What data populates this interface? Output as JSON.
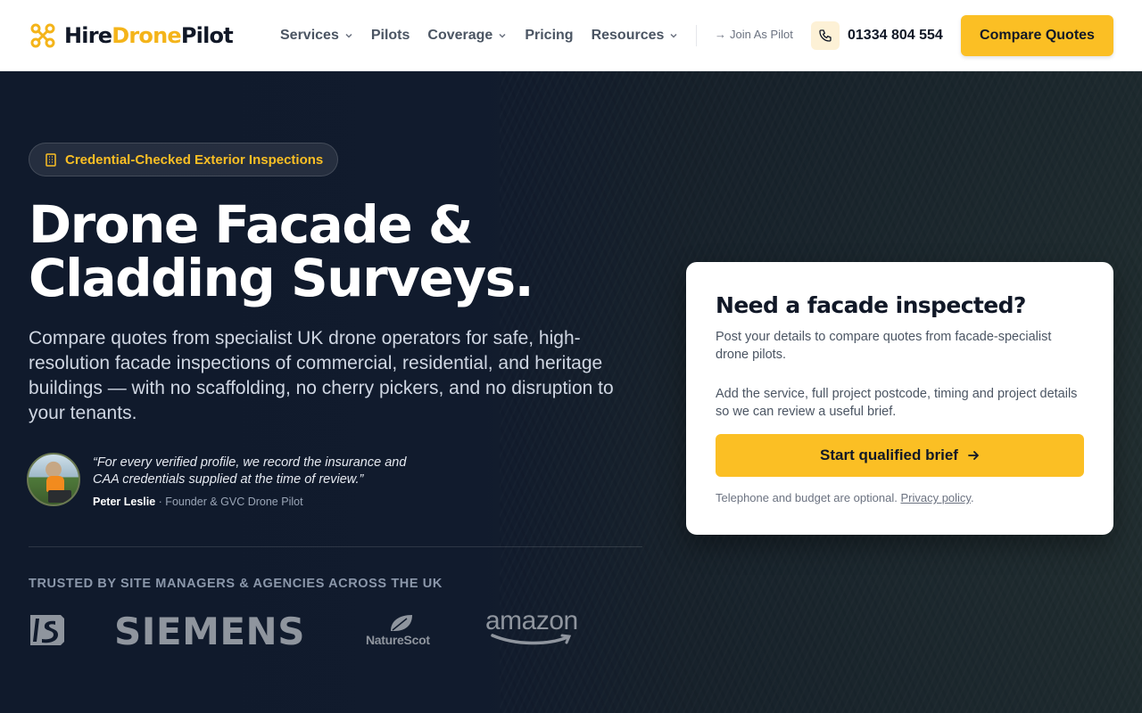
{
  "header": {
    "logo": {
      "part1": "Hire",
      "part2": "Drone",
      "part3": "Pilot"
    },
    "nav": [
      {
        "label": "Services",
        "has_dropdown": true
      },
      {
        "label": "Pilots",
        "has_dropdown": false
      },
      {
        "label": "Coverage",
        "has_dropdown": true
      },
      {
        "label": "Pricing",
        "has_dropdown": false
      },
      {
        "label": "Resources",
        "has_dropdown": true
      }
    ],
    "join_label": "Join As Pilot",
    "phone": "01334 804 554",
    "cta_label": "Compare Quotes"
  },
  "hero": {
    "badge": "Credential-Checked Exterior Inspections",
    "title_line1": "Drone Facade &",
    "title_line2": "Cladding Surveys.",
    "subtitle": "Compare quotes from specialist UK drone operators for safe, high-resolution facade inspections of commercial, residential, and heritage buildings — with no scaffolding, no cherry pickers, and no disruption to your tenants.",
    "quote": "“For every verified profile, we record the insurance and CAA credentials supplied at the time of review.”",
    "quote_author": "Peter Leslie",
    "quote_role": "· Founder & GVC Drone Pilot",
    "trusted_label": "TRUSTED BY SITE MANAGERS & AGENCIES ACROSS THE UK",
    "logos": {
      "siemens": "SIEMENS",
      "naturescot": "NatureScot",
      "amazon": "amazon"
    }
  },
  "form_card": {
    "title": "Need a facade inspected?",
    "paragraph1": "Post your details to compare quotes from facade-specialist drone pilots.",
    "paragraph2": "Add the service, full project postcode, timing and project details so we can review a useful brief.",
    "button_label": "Start qualified brief",
    "note": "Telephone and budget are optional.",
    "privacy_link": "Privacy policy",
    "note_end": "."
  },
  "colors": {
    "accent": "#fbbf24",
    "hero_bg": "#101a2c",
    "text_dark": "#111827"
  },
  "icons": [
    "drone-logo-icon",
    "chevron-down-icon",
    "arrow-right-icon",
    "phone-icon",
    "building-icon"
  ]
}
